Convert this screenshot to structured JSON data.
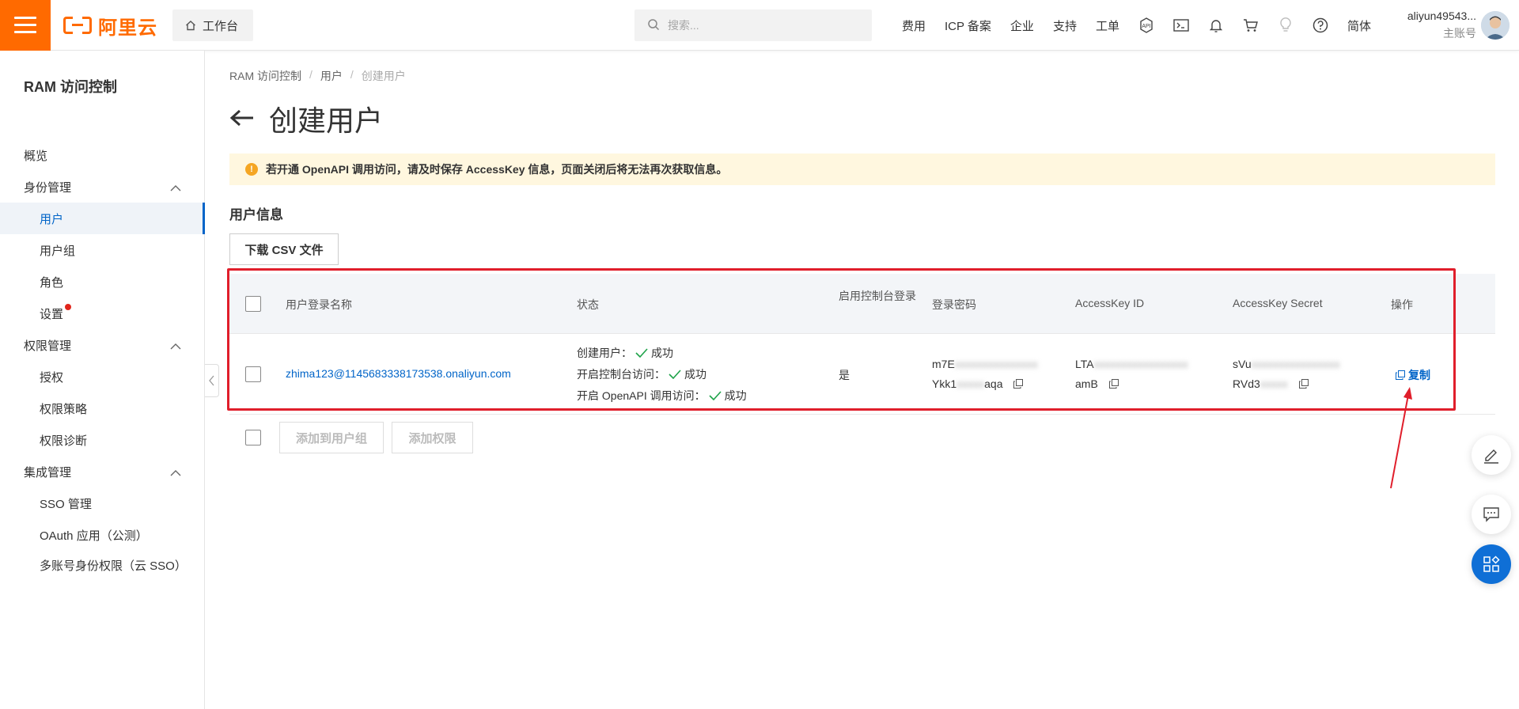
{
  "topbar": {
    "logo_text": "阿里云",
    "workbench_label": "工作台",
    "search_placeholder": "搜索...",
    "nav_items": [
      "费用",
      "ICP 备案",
      "企业",
      "支持",
      "工单"
    ],
    "icons": [
      "api-icon",
      "terminal-icon",
      "bell-icon",
      "cart-icon",
      "bulb-icon",
      "help-icon"
    ],
    "lang": "简体",
    "user_name": "aliyun49543...",
    "user_role": "主账号",
    "accent_color": "#ff6a00"
  },
  "sidebar": {
    "title": "RAM 访问控制",
    "items": [
      {
        "label": "概览"
      },
      {
        "label": "身份管理"
      },
      {
        "label": "用户"
      },
      {
        "label": "用户组"
      },
      {
        "label": "角色"
      },
      {
        "label": "设置"
      },
      {
        "label": "权限管理"
      },
      {
        "label": "授权"
      },
      {
        "label": "权限策略"
      },
      {
        "label": "权限诊断"
      },
      {
        "label": "集成管理"
      },
      {
        "label": "SSO 管理"
      },
      {
        "label": "OAuth 应用（公测）"
      },
      {
        "label": "多账号身份权限（云 SSO）"
      }
    ],
    "active_color": "#0064c8"
  },
  "breadcrumb": {
    "items": [
      "RAM 访问控制",
      "用户",
      "创建用户"
    ]
  },
  "page": {
    "title": "创建用户",
    "alert": "若开通 OpenAPI 调用访问，请及时保存 AccessKey 信息，页面关闭后将无法再次获取信息。",
    "section_title": "用户信息",
    "download_csv": "下载 CSV 文件"
  },
  "table": {
    "headers": [
      "用户登录名称",
      "状态",
      "启用控制台登录",
      "登录密码",
      "AccessKey ID",
      "AccessKey Secret",
      "操作"
    ],
    "row": {
      "login_name": "zhima123@1145683338173538.onaliyun.com",
      "status": [
        {
          "label": "创建用户：",
          "result": "成功"
        },
        {
          "label": "开启控制台访问：",
          "result": "成功"
        },
        {
          "label": "开启 OpenAPI 调用访问：",
          "result": "成功"
        }
      ],
      "console_login": "是",
      "password_line1_prefix": "m7E",
      "password_line1_hidden": "xxxxxxxxxxxxxxx",
      "password_line2_prefix": "Ykk1",
      "password_line2_hidden": "xxxxx",
      "password_line2_suffix": "aqa",
      "ak_id_line1_prefix": "LTA",
      "ak_id_line1_hidden": "xxxxxxxxxxxxxxxxx",
      "ak_id_line2_prefix": "amB",
      "ak_secret_line1_prefix": "sVu",
      "ak_secret_line1_hidden": "xxxxxxxxxxxxxxxx",
      "ak_secret_line2_prefix": "RVd3",
      "ak_secret_line2_hidden": "xxxxx",
      "action": "复制"
    },
    "bulk_buttons": [
      "添加到用户组",
      "添加权限"
    ]
  },
  "annotation_color": "#e01e2b"
}
